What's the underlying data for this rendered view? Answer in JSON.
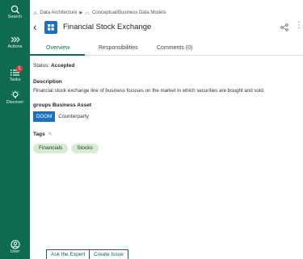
{
  "rail": {
    "search": "Search",
    "actions": "Actions",
    "tasks": "Tasks",
    "tasks_badge": "1",
    "discover": "Discover",
    "user": "User"
  },
  "breadcrumb": {
    "item1": "Data Architecture",
    "item2": "Conceptual/Business Data Models"
  },
  "header": {
    "title": "Financial Stock Exchange"
  },
  "tabs": [
    {
      "label": "Overview"
    },
    {
      "label": "Responsibilities"
    },
    {
      "label": "Comments (0)"
    }
  ],
  "overview": {
    "status_label": "Status:",
    "status_value": "Accepted",
    "description_heading": "Description",
    "description_text": "Financial stock exchange line of business focuses on the market in which securities are bought and sold.",
    "groups_heading": "groups Business Asset",
    "domain_badge": "DOOM",
    "domain_name": "Counterparty",
    "tags_heading": "Tags",
    "tags": [
      "Financials",
      "Stocks"
    ]
  },
  "footer": {
    "ask_expert": "Ask the Expert",
    "create_issue": "Create Issue"
  },
  "colors": {
    "rail": "#0e6b4f",
    "accent": "#0e6b4f",
    "asset_icon": "#1f6fbf",
    "tag_bg": "#d6ebd2",
    "badge": "#e23c3c"
  }
}
